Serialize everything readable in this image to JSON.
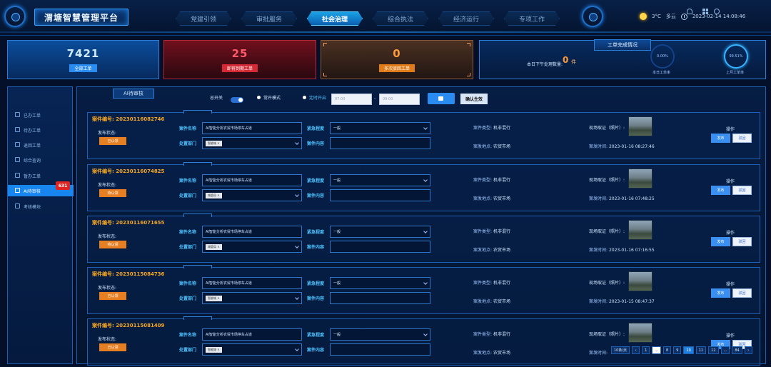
{
  "header": {
    "title": "渭塘智慧管理平台",
    "nav": [
      {
        "label": "党建引领",
        "active": false
      },
      {
        "label": "审批服务",
        "active": false
      },
      {
        "label": "社会治理",
        "active": true
      },
      {
        "label": "综合执法",
        "active": false
      },
      {
        "label": "经济运行",
        "active": false
      },
      {
        "label": "专项工作",
        "active": false
      }
    ],
    "temperature": "3°C",
    "weather": "多云",
    "datetime": "2023-02-14 14:08:46"
  },
  "stats": [
    {
      "value": "7421",
      "label": "全部工单"
    },
    {
      "value": "25",
      "label": "即将到期工单"
    },
    {
      "value": "0",
      "label": "多次驳回工单"
    }
  ],
  "completion": {
    "title": "工单完成情况",
    "text": "本日下午处理数量:",
    "count": "0",
    "unit": "件",
    "gauges": [
      {
        "value": "0.00%",
        "label": "本日工单率"
      },
      {
        "value": "99.51%",
        "label": "上月工单率"
      }
    ]
  },
  "colors": {
    "accent": "#1786ee",
    "warning": "#e67e22",
    "danger": "#e02424"
  },
  "sidebar": {
    "items": [
      {
        "label": "已办工单",
        "active": false
      },
      {
        "label": "待办工单",
        "active": false
      },
      {
        "label": "退回工单",
        "active": false
      },
      {
        "label": "综合查询",
        "active": false
      },
      {
        "label": "暂办工单",
        "active": false
      },
      {
        "label": "AI待审核",
        "active": true
      },
      {
        "label": "考核模块",
        "active": false
      }
    ],
    "badge": "631"
  },
  "main": {
    "tab": "AI待审核",
    "master_switch": "总开关",
    "mode_always": "常开模式",
    "mode_timed": "定时开启",
    "time_start_placeholder": "07:00",
    "time_end_placeholder": "09:00",
    "time_separator": "-",
    "confirm": "确认生效"
  },
  "case_labels": {
    "publish_status": "发布状态:",
    "case_name": "案件名称",
    "urgency": "紧急程度",
    "case_content": "案件内容",
    "case_type": "案件类型:",
    "case_location": "案发地点:",
    "evidence": "现场取证（照片）:",
    "time": "案发时间:",
    "operate": "操作",
    "publish": "发布",
    "reject": "驳回"
  },
  "cases": [
    {
      "no": "案件编号: 20230116082746",
      "status": "已认领",
      "name": "AI智能分析农贸市场停车占道",
      "urgency": "一般",
      "dept_label": "处置部门",
      "dept_tag": "智能城 ×",
      "type": "机非混行",
      "location": "农贸市场",
      "time": "2023-01-16 08:27:46"
    },
    {
      "no": "案件编号: 20230116074825",
      "status": "待认领",
      "name": "AI智能分析农贸市场停车占道",
      "urgency": "一般",
      "dept_label": "处置部门",
      "dept_tag": "城管局 ×",
      "type": "机非混行",
      "location": "农贸市场",
      "time": "2023-01-16 07:48:25"
    },
    {
      "no": "案件编号: 20230116071655",
      "status": "待认领",
      "name": "AI智能分析农贸市场停车占道",
      "urgency": "一般",
      "dept_label": "处置部门",
      "dept_tag": "城管局 ×",
      "type": "机非混行",
      "location": "农贸市场",
      "time": "2023-01-16 07:16:55"
    },
    {
      "no": "案件编号: 20230115084736",
      "status": "已认领",
      "name": "AI智能分析农贸市场停车占道",
      "urgency": "一般",
      "dept_label": "处置部门",
      "dept_tag": "智能城 ×",
      "type": "机非混行",
      "location": "农贸市场",
      "time": "2023-01-15 08:47:37"
    },
    {
      "no": "案件编号: 20230115081409",
      "status": "已认领",
      "name": "AI智能分析农贸市场停车占道",
      "urgency": "一般",
      "dept_label": "处置部门",
      "dept_tag": "智能城 ×",
      "type": "机非混行",
      "location": "农贸市场",
      "time": ""
    }
  ],
  "pager": {
    "page_size": "10条/页",
    "pages": [
      "1",
      "...",
      "8",
      "9",
      "10",
      "11",
      "12",
      "...",
      "84"
    ],
    "current": "10"
  }
}
